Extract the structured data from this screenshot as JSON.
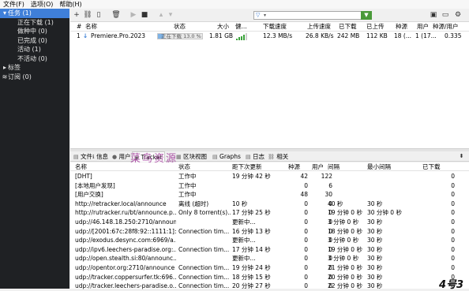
{
  "menu": [
    "文件(F)",
    "选项(O)",
    "帮助(H)"
  ],
  "sidebar": {
    "items": [
      {
        "icon": "▾",
        "label": "任务 (1)",
        "selected": true,
        "indent": 0
      },
      {
        "icon": "",
        "label": "正在下载 (1)",
        "indent": 1
      },
      {
        "icon": "",
        "label": "做种中 (0)",
        "indent": 1
      },
      {
        "icon": "",
        "label": "已完成 (0)",
        "indent": 1
      },
      {
        "icon": "",
        "label": "活动 (1)",
        "indent": 1
      },
      {
        "icon": "",
        "label": "不活动 (0)",
        "indent": 1
      },
      {
        "icon": "▸",
        "label": "标签",
        "indent": 0
      },
      {
        "icon": "≋",
        "label": "订阅 (0)",
        "indent": 0
      }
    ]
  },
  "toolbar": {
    "add": "+",
    "link": "⛓",
    "file": "▯",
    "delete": "🗑",
    "up": "▴",
    "down": "▾",
    "start": "▶",
    "pause": "■",
    "prev": "‹",
    "next": "›",
    "filter_icon": "▽",
    "filter_btn": "▼",
    "chat": "▣",
    "monitor": "▭",
    "settings": "⚙"
  },
  "list": {
    "headers": [
      "#",
      "名称",
      "状态",
      "大小",
      "健...",
      "下载速度",
      "上传速度",
      "已下载",
      "已上传",
      "种源",
      "用户",
      "种源/用户"
    ],
    "rows": [
      {
        "num": "1",
        "arrow": "↓",
        "name": "Premiere.Pro.2023",
        "status_text": "正在下载 13.0 %",
        "progress": 0.13,
        "size": "1.81 GB",
        "health": 4,
        "down": "12.3 MB/s",
        "up": "26.8 KB/s",
        "downloaded": "242 MB",
        "uploaded": "112 KB",
        "seeds": "18 (...",
        "peers": "1 (17...",
        "ratio": "0.335"
      }
    ]
  },
  "tabs": [
    {
      "icon": "▤",
      "label": "文件"
    },
    {
      "icon": "ℹ",
      "label": "信息"
    },
    {
      "icon": "●",
      "label": "用户"
    },
    {
      "icon": "◉",
      "label": "Tracker",
      "selected": true
    },
    {
      "icon": "▦",
      "label": "区块视图"
    },
    {
      "icon": "▤",
      "label": "Graphs"
    },
    {
      "icon": "▤",
      "label": "日志"
    },
    {
      "icon": "⛓",
      "label": "相关"
    }
  ],
  "watermark": "菜鸟资源",
  "tracker": {
    "headers": [
      "名称",
      "状态",
      "距下次更新",
      "种源",
      "用户",
      "间隔",
      "最小间隔",
      "已下载"
    ],
    "rows": [
      [
        "[DHT]",
        "工作中",
        "19 分钟 42 秒",
        "42",
        "122",
        "",
        "",
        "0"
      ],
      [
        "[本地用户发现]",
        "工作中",
        "",
        "0",
        "6",
        "",
        "",
        "0"
      ],
      [
        "[用户交换]",
        "工作中",
        "",
        "48",
        "30",
        "",
        "",
        "0"
      ],
      [
        "http://retracker.local/announce",
        "离线 (超时)",
        "10 秒",
        "0",
        "0",
        "40 秒",
        "30 秒",
        "0"
      ],
      [
        "http://rutracker.ru/bt/announce.p...",
        "Only 8 torrent(s)...",
        "17 分钟 25 秒",
        "0",
        "0",
        "19 分钟 0 秒",
        "30 分钟 0 秒",
        "0"
      ],
      [
        "udp://46.148.18.250:2710/announ...",
        "",
        "更新中...",
        "0",
        "0",
        "3 分钟 0 秒",
        "30 秒",
        "0"
      ],
      [
        "udp://[2001:67c:28f8:92::1111:1]:...",
        "Connection tim...",
        "16 分钟 13 秒",
        "0",
        "0",
        "18 分钟 0 秒",
        "30 秒",
        "0"
      ],
      [
        "udp://exodus.desync.com:6969/a...",
        "",
        "更新中...",
        "0",
        "0",
        "3 分钟 0 秒",
        "30 秒",
        "0"
      ],
      [
        "udp://ipv6.leechers-paradise.org:...",
        "Connection tim...",
        "17 分钟 14 秒",
        "0",
        "0",
        "19 分钟 0 秒",
        "30 秒",
        "0"
      ],
      [
        "udp://open.stealth.si:80/announc...",
        "",
        "更新中...",
        "0",
        "0",
        "3 分钟 0 秒",
        "30 秒",
        "0"
      ],
      [
        "udp://opentor.org:2710/announce",
        "Connection tim...",
        "19 分钟 24 秒",
        "0",
        "0",
        "21 分钟 0 秒",
        "30 秒",
        "0"
      ],
      [
        "udp://tracker.coppersurfer.tk:696...",
        "Connection tim...",
        "18 分钟 15 秒",
        "0",
        "0",
        "20 分钟 0 秒",
        "30 秒",
        "0"
      ],
      [
        "udp://tracker.leechers-paradise.o...",
        "Connection tim...",
        "20 分钟 27 秒",
        "0",
        "0",
        "22 分钟 0 秒",
        "30 秒",
        "0"
      ]
    ]
  },
  "corner_logo": "4号3"
}
